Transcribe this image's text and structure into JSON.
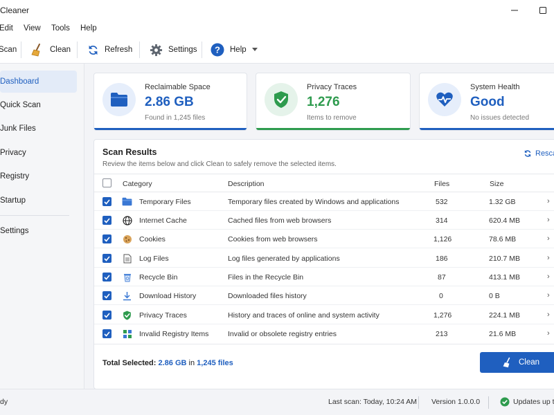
{
  "window": {
    "title": "Cleaner"
  },
  "menu": [
    "Edit",
    "View",
    "Tools",
    "Help"
  ],
  "toolbar": {
    "scan": "Scan",
    "clean": "Clean",
    "refresh": "Refresh",
    "settings": "Settings",
    "help": "Help"
  },
  "sidebar": {
    "items": [
      {
        "label": "Dashboard",
        "active": true
      },
      {
        "label": "Quick Scan"
      },
      {
        "label": "Junk Files"
      },
      {
        "label": "Privacy"
      },
      {
        "label": "Registry"
      },
      {
        "label": "Startup"
      },
      {
        "label": "Settings"
      }
    ]
  },
  "cards": [
    {
      "label": "Reclaimable Space",
      "value": "2.86 GB",
      "sub": "Found in 1,245 files",
      "color": "#1f5fbf",
      "icon": "folder-icon"
    },
    {
      "label": "Privacy Traces",
      "value": "1,276",
      "sub": "Items to remove",
      "color": "#2e9b4e",
      "icon": "shield-check-icon"
    },
    {
      "label": "System Health",
      "value": "Good",
      "sub": "No issues detected",
      "color": "#1f5fbf",
      "icon": "heart-pulse-icon"
    }
  ],
  "results": {
    "title": "Scan Results",
    "description": "Review the items below and click Clean to safely remove the selected items.",
    "rescan": "Rescan",
    "columns": {
      "category": "Category",
      "description": "Description",
      "files": "Files",
      "size": "Size"
    },
    "rows": [
      {
        "category": "Temporary Files",
        "description": "Temporary files created by Windows and applications",
        "files": "532",
        "size": "1.32 GB",
        "icon": "folder-icon"
      },
      {
        "category": "Internet Cache",
        "description": "Cached files from web browsers",
        "files": "314",
        "size": "620.4 MB",
        "icon": "globe-icon"
      },
      {
        "category": "Cookies",
        "description": "Cookies from web browsers",
        "files": "1,126",
        "size": "78.6 MB",
        "icon": "cookie-icon"
      },
      {
        "category": "Log Files",
        "description": "Log files generated by applications",
        "files": "186",
        "size": "210.7 MB",
        "icon": "document-icon"
      },
      {
        "category": "Recycle Bin",
        "description": "Files in the Recycle Bin",
        "files": "87",
        "size": "413.1 MB",
        "icon": "recycle-bin-icon"
      },
      {
        "category": "Download History",
        "description": "Downloaded files history",
        "files": "0",
        "size": "0 B",
        "icon": "download-icon"
      },
      {
        "category": "Privacy Traces",
        "description": "History and traces of online and system activity",
        "files": "1,276",
        "size": "224.1 MB",
        "icon": "shield-check-icon"
      },
      {
        "category": "Invalid Registry Items",
        "description": "Invalid or obsolete registry entries",
        "files": "213",
        "size": "21.6 MB",
        "icon": "registry-icon"
      }
    ],
    "total_label": "Total Selected:",
    "total_size": "2.86 GB",
    "total_in": "in",
    "total_files": "1,245 files",
    "clean_button": "Clean"
  },
  "status": {
    "left": "dy",
    "last_scan": "Last scan: Today, 10:24 AM",
    "version": "Version 1.0.0.0",
    "updates": "Updates up to"
  },
  "colors": {
    "accent": "#1f5fbf",
    "success": "#2e9b4e"
  }
}
